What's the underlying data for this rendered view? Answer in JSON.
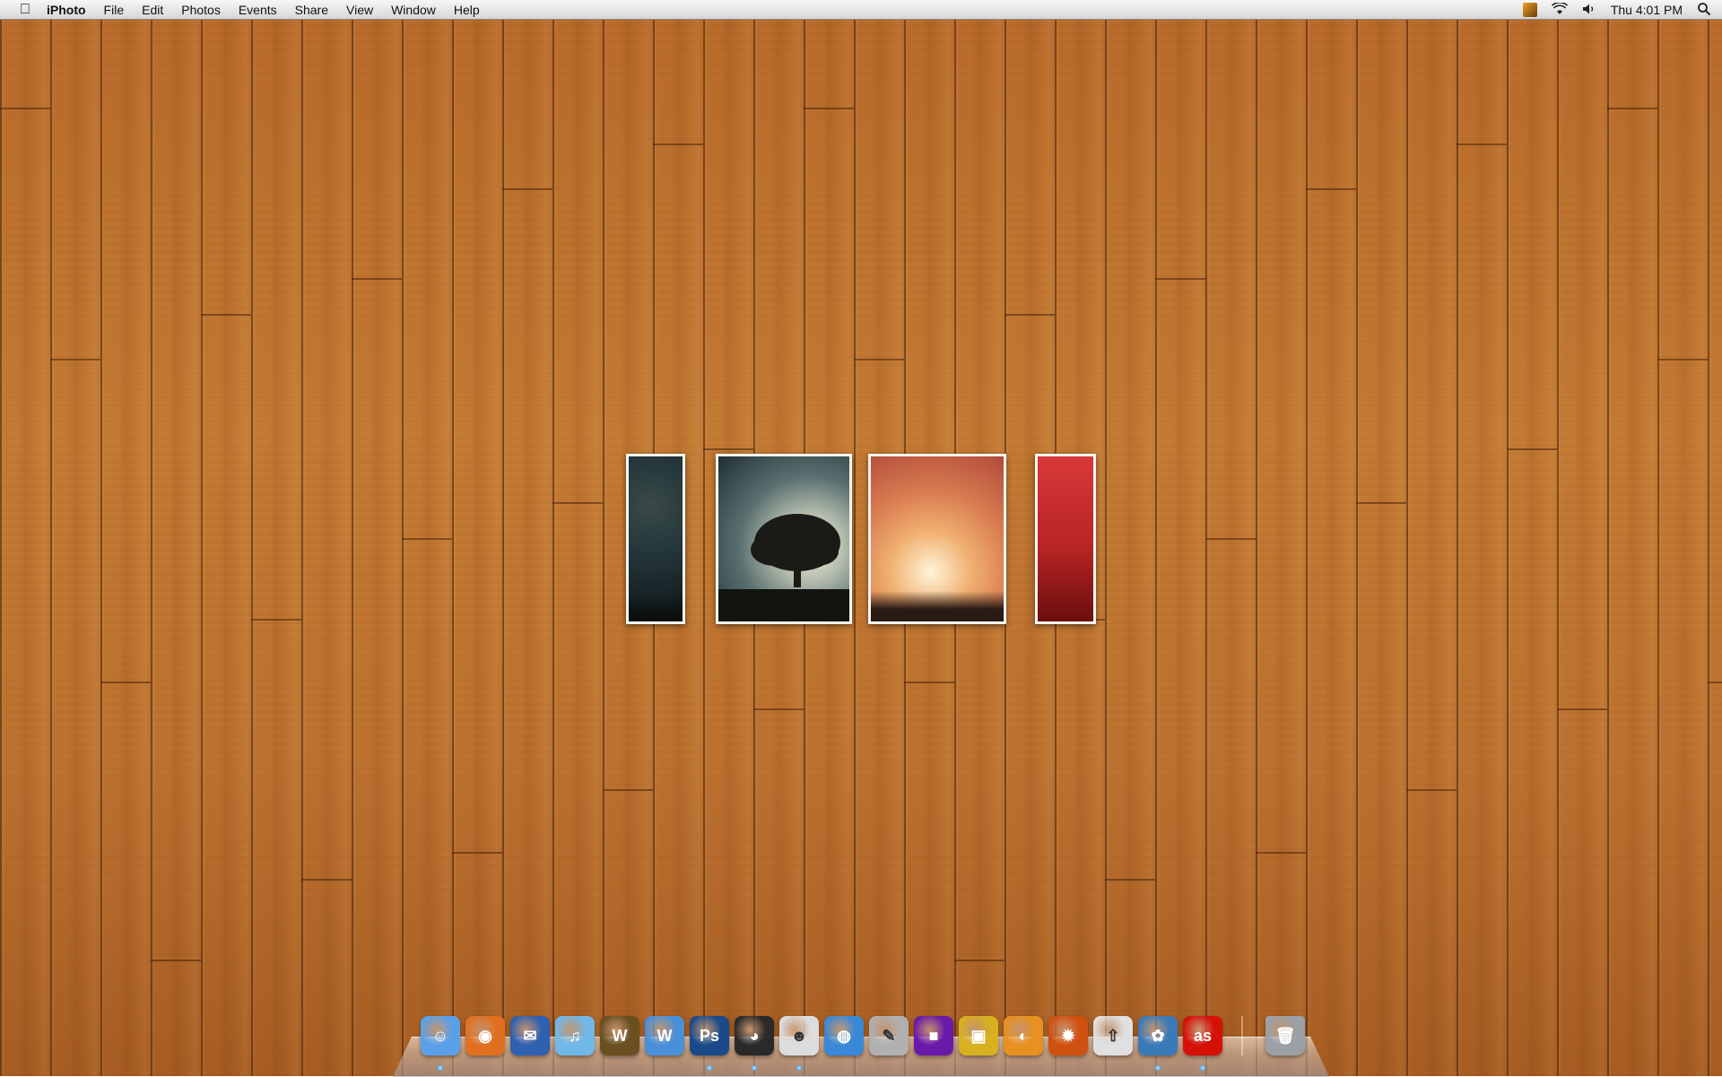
{
  "menubar": {
    "apple_icon": "apple-icon",
    "app_name": "iPhoto",
    "items": [
      "File",
      "Edit",
      "Photos",
      "Events",
      "Share",
      "View",
      "Window",
      "Help"
    ],
    "status": {
      "clock": "Thu 4:01 PM",
      "icons": [
        "user-picture-icon",
        "wifi-icon",
        "volume-icon",
        "spotlight-search-icon"
      ]
    }
  },
  "desktop": {
    "photos": [
      {
        "name": "photo-night-sky-narrow",
        "colors": [
          "#0e1618",
          "#24363c",
          "#3a4a48"
        ]
      },
      {
        "name": "photo-tree-silhouette",
        "colors": [
          "#263a3e",
          "#8aa0a0",
          "#e6e4cc"
        ]
      },
      {
        "name": "photo-starry-sunset",
        "colors": [
          "#e8d8c0",
          "#e8a060",
          "#c05a3a"
        ]
      },
      {
        "name": "photo-red-narrow",
        "colors": [
          "#d03030",
          "#b02020",
          "#7a1010"
        ]
      }
    ]
  },
  "dock": {
    "apps": [
      {
        "name": "finder",
        "icon": "finder-icon",
        "glyph": "☺",
        "color": "#5aa0e8",
        "running": true
      },
      {
        "name": "firefox",
        "icon": "firefox-icon",
        "glyph": "◉",
        "color": "#e07020",
        "running": false
      },
      {
        "name": "thunderbird",
        "icon": "mail-icon",
        "glyph": "✉",
        "color": "#3060b0",
        "running": false
      },
      {
        "name": "itunes",
        "icon": "itunes-icon",
        "glyph": "♫",
        "color": "#70b8e8",
        "running": false
      },
      {
        "name": "world-of-warcraft",
        "icon": "warcraft-icon",
        "glyph": "W",
        "color": "#6a5020",
        "running": false
      },
      {
        "name": "word",
        "icon": "word-icon",
        "glyph": "W",
        "color": "#4a90d8",
        "running": false
      },
      {
        "name": "photoshop",
        "icon": "photoshop-icon",
        "glyph": "Ps",
        "color": "#1a4a8a",
        "running": true
      },
      {
        "name": "adium",
        "icon": "adium-icon",
        "glyph": "◕",
        "color": "#2a2a2a",
        "running": true
      },
      {
        "name": "messenger",
        "icon": "messenger-icon",
        "glyph": "☻",
        "color": "#dddddd",
        "running": true
      },
      {
        "name": "system-tool",
        "icon": "globe-icon",
        "glyph": "◍",
        "color": "#3a88d8",
        "running": false
      },
      {
        "name": "script-editor",
        "icon": "script-icon",
        "glyph": "✎",
        "color": "#b0b0b0",
        "running": false
      },
      {
        "name": "purple-app",
        "icon": "square-icon",
        "glyph": "■",
        "color": "#6a1aa8",
        "running": false
      },
      {
        "name": "transmit",
        "icon": "truck-icon",
        "glyph": "▣",
        "color": "#d8b020",
        "running": false
      },
      {
        "name": "adium-duck",
        "icon": "duck-icon",
        "glyph": "◐",
        "color": "#e89020",
        "running": false
      },
      {
        "name": "burn",
        "icon": "fire-icon",
        "glyph": "✹",
        "color": "#d05010",
        "running": false
      },
      {
        "name": "flickr-uploadr",
        "icon": "flickr-icon",
        "glyph": "⇧",
        "color": "#e0e0e0",
        "running": false
      },
      {
        "name": "iphoto",
        "icon": "iphoto-icon",
        "glyph": "✿",
        "color": "#3a7ab8",
        "running": true
      },
      {
        "name": "lastfm",
        "icon": "lastfm-icon",
        "glyph": "as",
        "color": "#d51007",
        "running": true
      }
    ],
    "trash": {
      "name": "trash",
      "icon": "trash-icon",
      "glyph": "🗑",
      "color": "#9aa0a6"
    }
  }
}
